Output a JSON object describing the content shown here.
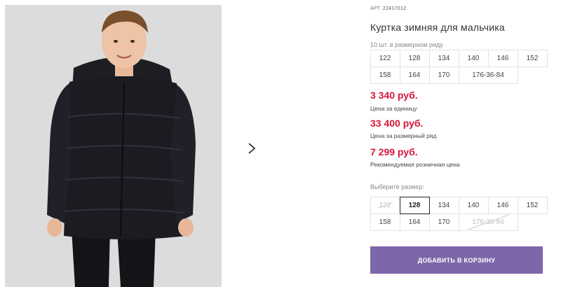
{
  "product": {
    "sku_label": "АРТ.",
    "sku_number": "22417012",
    "title": "Куртка зимняя для мальчика",
    "range_note": "10 шт. в размерном ряду",
    "range_sizes": [
      "122",
      "128",
      "134",
      "140",
      "146",
      "152",
      "158",
      "164",
      "170",
      "176-36-84"
    ]
  },
  "prices": [
    {
      "value": "3 340 руб.",
      "label": "Цена за единицу"
    },
    {
      "value": "33 400 руб.",
      "label": "Цена за размерный ряд"
    },
    {
      "value": "7 299 руб.",
      "label": "Рекомендуемая розничная цена"
    }
  ],
  "size_picker": {
    "label": "Выберите размер:",
    "options": [
      {
        "label": "122",
        "state": "unavailable"
      },
      {
        "label": "128",
        "state": "selected"
      },
      {
        "label": "134",
        "state": "available"
      },
      {
        "label": "140",
        "state": "available"
      },
      {
        "label": "146",
        "state": "available"
      },
      {
        "label": "152",
        "state": "available"
      },
      {
        "label": "158",
        "state": "available"
      },
      {
        "label": "164",
        "state": "available"
      },
      {
        "label": "170",
        "state": "available"
      },
      {
        "label": "176-36-84",
        "state": "unavailable"
      }
    ]
  },
  "cart_button": {
    "label": "ДОБАВИТЬ В КОРЗИНУ"
  },
  "colors": {
    "price": "#d6163a",
    "button": "#7d66a9",
    "photo_bg": "#dcdcdc"
  },
  "icons": {
    "next": "chevron-right-icon"
  }
}
